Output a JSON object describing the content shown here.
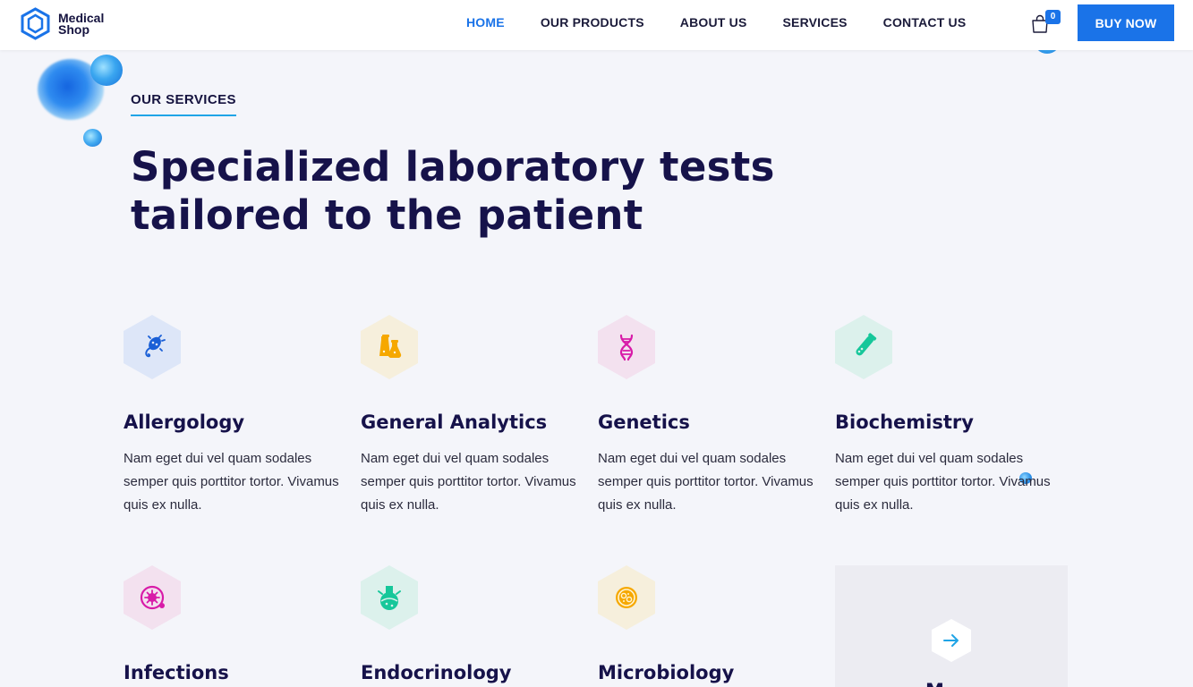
{
  "header": {
    "logo_line1": "Medical",
    "logo_line2": "Shop",
    "nav": [
      {
        "label": "HOME",
        "active": true
      },
      {
        "label": "OUR PRODUCTS",
        "active": false
      },
      {
        "label": "ABOUT US",
        "active": false
      },
      {
        "label": "SERVICES",
        "active": false
      },
      {
        "label": "CONTACT US",
        "active": false
      }
    ],
    "cart_count": "0",
    "buy_label": "BUY NOW"
  },
  "section": {
    "kicker": "OUR SERVICES",
    "headline_line1": "Specialized laboratory tests",
    "headline_line2": "tailored to the patient"
  },
  "services": [
    {
      "title": "Allergology",
      "icon": "bacteria-icon",
      "color": "#1a5fd6",
      "bg": "#dde6f8",
      "desc": "Nam eget dui vel quam sodales semper quis porttitor tortor. Vivamus quis ex nulla."
    },
    {
      "title": "General Analytics",
      "icon": "lab-flasks-icon",
      "color": "#f6a800",
      "bg": "#f6efdc",
      "desc": "Nam eget dui vel quam sodales semper quis porttitor tortor. Vivamus quis ex nulla."
    },
    {
      "title": "Genetics",
      "icon": "dna-icon",
      "color": "#d81ba8",
      "bg": "#f3e1ef",
      "desc": "Nam eget dui vel quam sodales semper quis porttitor tortor. Vivamus quis ex nulla."
    },
    {
      "title": "Biochemistry",
      "icon": "test-tube-icon",
      "color": "#16c79a",
      "bg": "#dcf1ec",
      "desc": "Nam eget dui vel quam sodales semper quis porttitor tortor. Vivamus quis ex nulla."
    },
    {
      "title": "Infections",
      "icon": "virus-icon",
      "color": "#d81ba8",
      "bg": "#f3e1ef",
      "desc": ""
    },
    {
      "title": "Endocrinology",
      "icon": "round-flask-icon",
      "color": "#16c79a",
      "bg": "#dcf1ec",
      "desc": ""
    },
    {
      "title": "Microbiology",
      "icon": "petri-dish-icon",
      "color": "#f6a800",
      "bg": "#f6efdc",
      "desc": ""
    }
  ],
  "more_card": {
    "label": "M"
  }
}
